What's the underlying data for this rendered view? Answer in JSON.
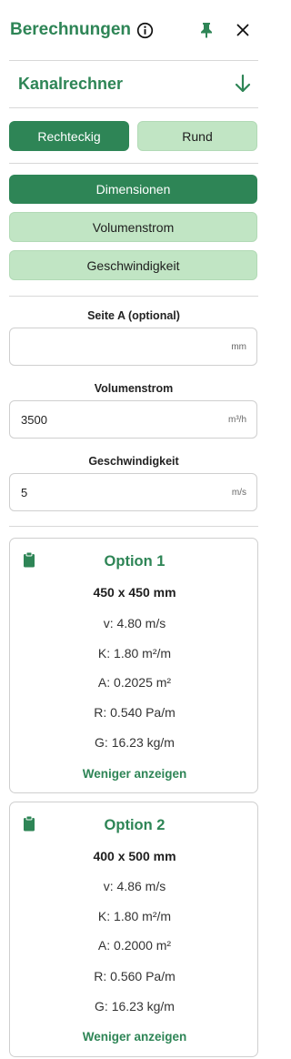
{
  "header": {
    "title": "Berechnungen"
  },
  "section": {
    "title": "Kanalrechner"
  },
  "shape_tabs": [
    {
      "label": "Rechteckig",
      "active": true
    },
    {
      "label": "Rund",
      "active": false
    }
  ],
  "mode_buttons": [
    {
      "label": "Dimensionen",
      "active": true
    },
    {
      "label": "Volumenstrom",
      "active": false
    },
    {
      "label": "Geschwindigkeit",
      "active": false
    }
  ],
  "fields": [
    {
      "label": "Seite A (optional)",
      "value": "",
      "unit": "mm"
    },
    {
      "label": "Volumenstrom",
      "value": "3500",
      "unit": "m³/h"
    },
    {
      "label": "Geschwindigkeit",
      "value": "5",
      "unit": "m/s"
    }
  ],
  "options": [
    {
      "title": "Option 1",
      "dimensions": "450 x 450 mm",
      "v": "v: 4.80 m/s",
      "k": "K: 1.80 m²/m",
      "a": "A: 0.2025 m²",
      "r": "R: 0.540 Pa/m",
      "g": "G: 16.23 kg/m",
      "toggle": "Weniger anzeigen"
    },
    {
      "title": "Option 2",
      "dimensions": "400 x 500 mm",
      "v": "v: 4.86 m/s",
      "k": "K: 1.80 m²/m",
      "a": "A: 0.2000 m²",
      "r": "R: 0.560 Pa/m",
      "g": "G: 16.23 kg/m",
      "toggle": "Weniger anzeigen"
    }
  ],
  "colors": {
    "accent": "#2e8556",
    "inactive_bg": "#c1e5c4"
  },
  "icons": [
    "info-icon",
    "pin-icon",
    "close-icon",
    "arrow-down-icon",
    "clipboard-icon"
  ]
}
